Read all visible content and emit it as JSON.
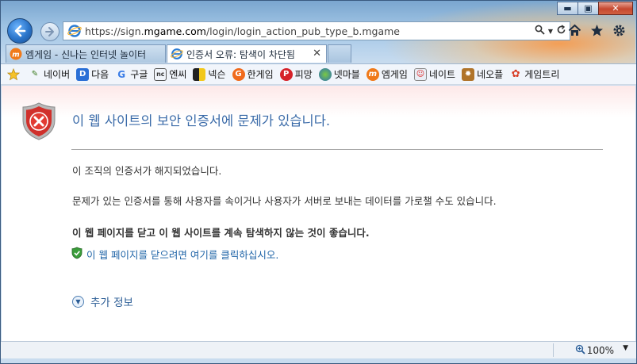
{
  "browser": {
    "address_url_prefix": "https://sign.",
    "address_url_domain": "mgame.com",
    "address_url_suffix": "/login/login_action_pub_type_b.mgame",
    "tabs": [
      {
        "label": "엠게임 - 신나는 인터넷 놀이터",
        "active": false
      },
      {
        "label": "인증서 오류: 탐색이 차단됨",
        "active": true
      }
    ],
    "favorites": [
      {
        "label": "",
        "icon": "favorites-star-icon"
      },
      {
        "label": "네이버",
        "icon": "naver-icon"
      },
      {
        "label": "다음",
        "icon": "daum-icon"
      },
      {
        "label": "구글",
        "icon": "google-icon"
      },
      {
        "label": "엔씨",
        "icon": "ncsoft-icon"
      },
      {
        "label": "넥슨",
        "icon": "nexon-icon"
      },
      {
        "label": "한게임",
        "icon": "hangame-icon"
      },
      {
        "label": "피망",
        "icon": "pmang-icon"
      },
      {
        "label": "넷마블",
        "icon": "netmarble-icon"
      },
      {
        "label": "엠게임",
        "icon": "mgame-icon"
      },
      {
        "label": "네이트",
        "icon": "nate-icon"
      },
      {
        "label": "네오플",
        "icon": "neople-icon"
      },
      {
        "label": "게임트리",
        "icon": "gametree-icon"
      }
    ]
  },
  "page": {
    "title": "이 웹 사이트의 보안 인증서에 문제가 있습니다.",
    "paragraph1": "이 조직의 인증서가 해지되었습니다.",
    "paragraph2": "문제가 있는 인증서를 통해 사용자를 속이거나 사용자가 서버로 보내는 데이터를 가로챌 수도 있습니다.",
    "recommendation": "이 웹 페이지를 닫고 이 웹 사이트를 계속 탐색하지 않는 것이 좋습니다.",
    "close_link": "이 웹 페이지를 닫으려면 여기를 클릭하십시오.",
    "more_info": "추가 정보"
  },
  "status": {
    "zoom": "100%"
  },
  "colors": {
    "title": "#3a6aa8",
    "link": "#1f64a7",
    "error_red": "#c8302a"
  }
}
